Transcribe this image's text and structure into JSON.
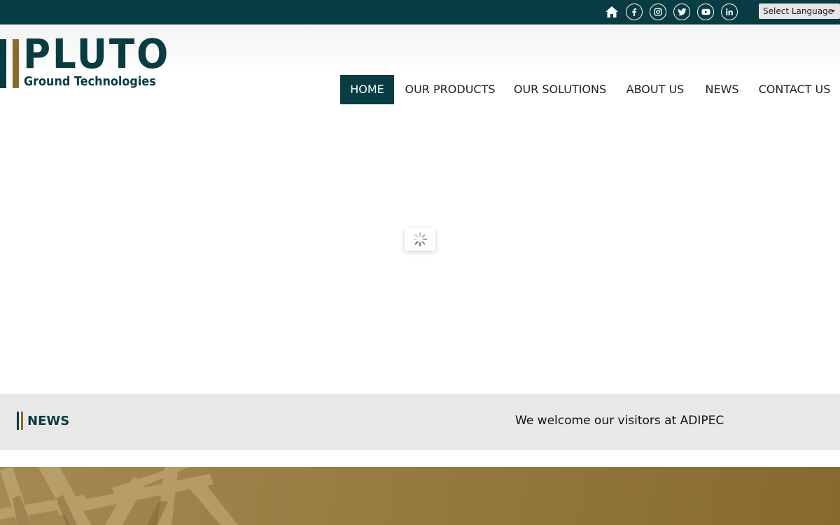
{
  "topbar": {
    "icons": [
      "home-icon",
      "facebook-icon",
      "instagram-icon",
      "twitter-icon",
      "youtube-icon",
      "linkedin-icon"
    ],
    "language_select": "Select Language"
  },
  "logo": {
    "brand": "PLUTO",
    "tagline": "Ground Technologies"
  },
  "nav": {
    "items": [
      {
        "label": "HOME",
        "active": true
      },
      {
        "label": "OUR PRODUCTS",
        "active": false
      },
      {
        "label": "OUR SOLUTIONS",
        "active": false
      },
      {
        "label": "ABOUT US",
        "active": false
      },
      {
        "label": "NEWS",
        "active": false
      },
      {
        "label": "CONTACT US",
        "active": false
      }
    ]
  },
  "news": {
    "title": "NEWS",
    "ticker": "We welcome our visitors at ADIPEC"
  },
  "colors": {
    "primary": "#063c42",
    "accent": "#8a6a2a",
    "ticker_bg": "#e8e8e8"
  }
}
